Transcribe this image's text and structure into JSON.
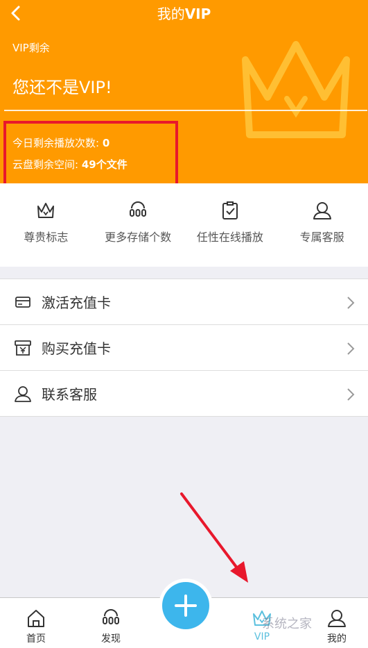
{
  "header": {
    "back_icon": "chevron-left-icon",
    "title_prefix": "我的",
    "title_suffix": "VIP",
    "vip_remaining_label": "VIP剩余",
    "status_text": "您还不是VIP!",
    "daily_plays_label": "今日剩余播放次数:",
    "daily_plays_value": "0",
    "cloud_space_label": "云盘剩余空间:",
    "cloud_space_value": "49个文件",
    "background_color": "#ff9a00"
  },
  "benefits": [
    {
      "label": "尊贵标志",
      "icon": "crown-icon"
    },
    {
      "label": "更多存储个数",
      "icon": "storage-icon"
    },
    {
      "label": "任性在线播放",
      "icon": "clipboard-check-icon"
    },
    {
      "label": "专属客服",
      "icon": "user-icon"
    }
  ],
  "menu": [
    {
      "label": "激活充值卡",
      "icon": "card-icon"
    },
    {
      "label": "购买充值卡",
      "icon": "yuan-card-icon"
    },
    {
      "label": "联系客服",
      "icon": "user-icon"
    }
  ],
  "tabbar": {
    "home": "首页",
    "discover": "发现",
    "vip": "VIP",
    "mine": "我的",
    "active_color": "#5bc0de",
    "fab_color": "#3db6ec"
  },
  "annotation_color": "#e8182c",
  "watermark": "系统之家"
}
